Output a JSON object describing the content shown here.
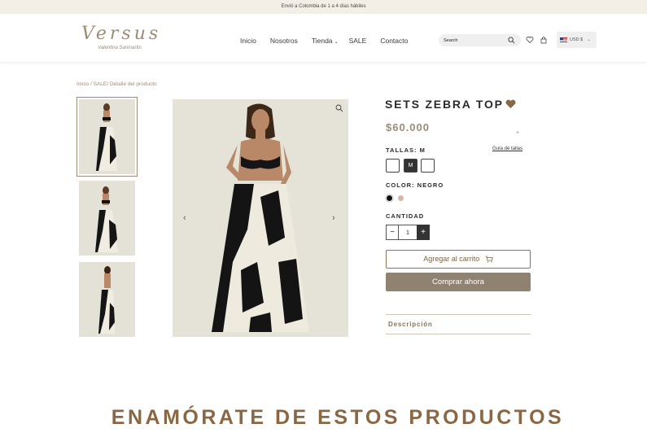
{
  "announcement": "Envió a Colombia de 1 a 4 días hábiles",
  "logo": {
    "main": "Versus",
    "sub": "Valentina Sanmartin"
  },
  "nav": {
    "items": [
      {
        "label": "Inicio"
      },
      {
        "label": "Nosotros"
      },
      {
        "label": "Tienda"
      },
      {
        "label": "SALE"
      },
      {
        "label": "Contacto"
      }
    ]
  },
  "search": {
    "placeholder": "Search"
  },
  "currency": {
    "label": "USD $"
  },
  "breadcrumb": "Inicio / SALE/ Detalle del producto",
  "product": {
    "title": "SETS ZEBRA TOP",
    "price": "$60.000",
    "sizes_label": "TALLAS: M",
    "size_guide": "Guía de tallas",
    "sizes": [
      "",
      "M",
      ""
    ],
    "selected_size": "M",
    "color_label": "COLOR: NEGRO",
    "colors": [
      "#111111",
      "#d9b5a5"
    ],
    "quantity_label": "CANTIDAD",
    "quantity": "1",
    "minus": "−",
    "plus": "+",
    "add_to_cart": "Agregar al carrito",
    "buy_now": "Comprar ahora",
    "description": "Descripción"
  },
  "section_title": "ENAMÓRATE DE ESTOS PRODUCTOS",
  "colors": {
    "brand": "#9c8c76",
    "accent_brown": "#8a6744",
    "buy_button": "#8f8270",
    "announcement_bg": "#f3efe7"
  }
}
